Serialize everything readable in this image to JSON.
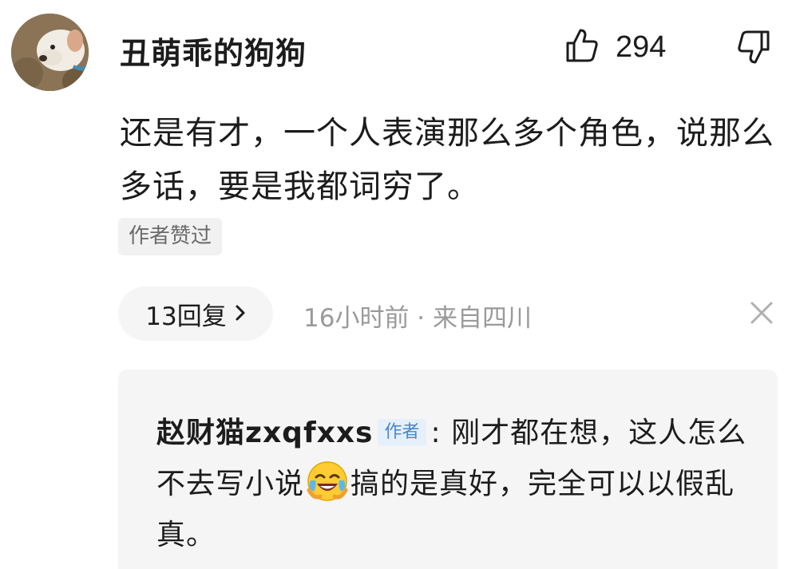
{
  "comment": {
    "username": "丑萌乖的狗狗",
    "text": "还是有才，一个人表演那么多个角色，说那么多话，要是我都词穷了。",
    "badge": "作者赞过",
    "like_count": "294",
    "replies_label": "13回复",
    "meta": "16小时前 · 来自四川"
  },
  "reply": {
    "author": "赵财猫zxqfxxs",
    "author_tag": "作者",
    "text_before_emoji": ": 刚才都在想，这人怎么不去写小说",
    "emoji": "laughing-crying-emoji",
    "text_after_emoji": "搞的是真好，完全可以以假乱真。"
  },
  "icons": {
    "like": "thumbs-up-icon",
    "dislike": "thumbs-down-icon",
    "chevron": "chevron-right-icon",
    "close": "close-icon"
  },
  "colors": {
    "text_primary": "#1c1c1c",
    "text_secondary": "#9a9a9a",
    "badge_bg": "#f1f1f1",
    "reply_bg": "#f5f5f5",
    "author_tag_bg": "#e6f0fb",
    "author_tag_fg": "#4a86c8"
  }
}
